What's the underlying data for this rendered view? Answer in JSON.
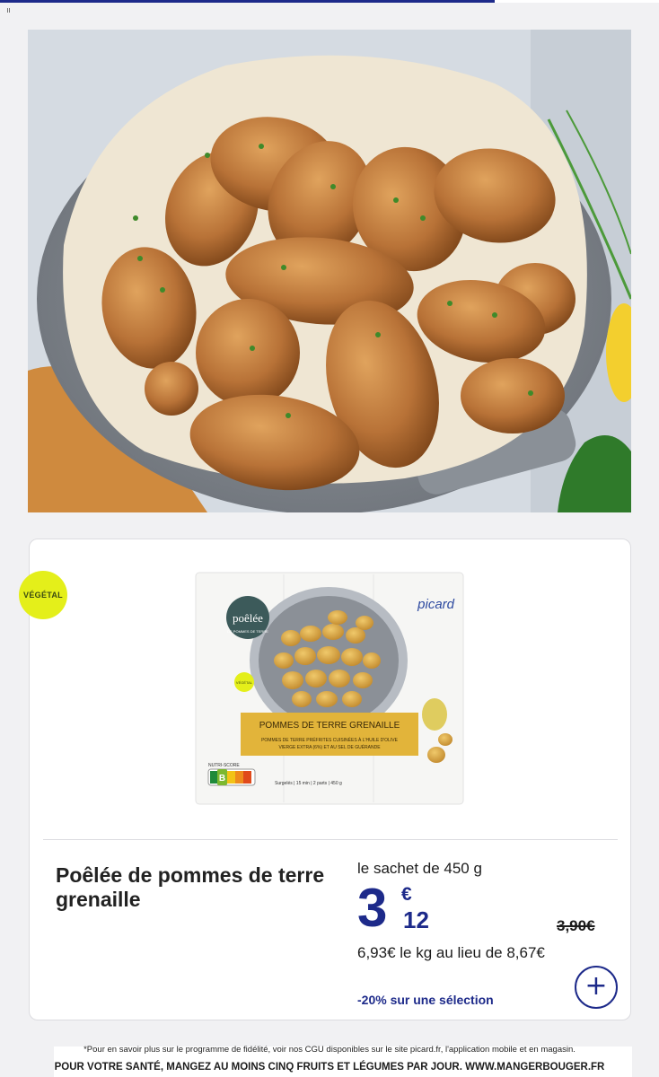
{
  "badge": {
    "label": "VÉGÉTAL"
  },
  "package": {
    "brand": "poêlée",
    "subbrand": "DE POMMES DE TERRE",
    "store_logo": "picard",
    "badge": "VÉGÉTAL",
    "band_title": "POMMES DE TERRE GRENAILLE",
    "band_desc_1": "POMMES DE TERRE PRÉFRITES CUISINÉES À L'HUILE D'OLIVE",
    "band_desc_2": "VIERGE EXTRA (6%) ET AU SEL DE GUÉRANDE",
    "nutriscore_label": "NUTRI-SCORE",
    "nutriscore_letters": [
      "A",
      "B",
      "C",
      "D",
      "E"
    ],
    "nutriscore_active": "B",
    "footer_info": "Surgelés | 15 min | 2 parts | 450 g"
  },
  "product": {
    "title": "Poêlée de pommes de terre grenaille",
    "unit": "le sachet de 450 g",
    "price_int": "3",
    "price_currency": "€",
    "price_dec": "12",
    "old_price": "3,90€",
    "per_kg": "6,93€ le kg au lieu de 8,67€",
    "promo": "-20% sur une sélection",
    "add_label": "+"
  },
  "footer": {
    "legal": "*Pour en savoir plus sur le programme de fidélité, voir nos CGU disponibles sur le site picard.fr, l'application mobile et en magasin.",
    "health": "POUR VOTRE SANTÉ, MANGEZ AU MOINS CINQ FRUITS ET LÉGUMES PAR JOUR. WWW.MANGERBOUGER.FR"
  },
  "colors": {
    "brand": "#1d2a8a",
    "badge": "#e4ef1a",
    "band": "#e2b43a"
  }
}
